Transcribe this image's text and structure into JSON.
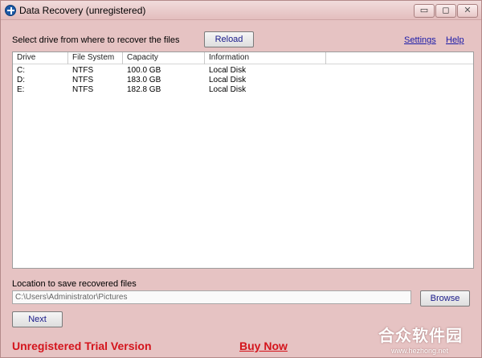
{
  "window": {
    "title": "Data Recovery (unregistered)",
    "min_glyph": "▭",
    "max_glyph": "◻",
    "close_glyph": "✕"
  },
  "top": {
    "prompt": "Select drive from where to recover the files",
    "reload_label": "Reload",
    "settings_label": "Settings",
    "help_label": "Help"
  },
  "drive_list": {
    "columns": [
      "Drive",
      "File System",
      "Capacity",
      "Information",
      ""
    ],
    "rows": [
      {
        "drive": "C:",
        "fs": "NTFS",
        "capacity": "100.0 GB",
        "info": "Local Disk"
      },
      {
        "drive": "D:",
        "fs": "NTFS",
        "capacity": "183.0 GB",
        "info": "Local Disk"
      },
      {
        "drive": "E:",
        "fs": "NTFS",
        "capacity": "182.8 GB",
        "info": "Local Disk"
      }
    ]
  },
  "save": {
    "label": "Location to save recovered files",
    "path": "C:\\Users\\Administrator\\Pictures",
    "browse_label": "Browse"
  },
  "footer": {
    "next_label": "Next",
    "trial_text": "Unregistered Trial Version",
    "buy_label": "Buy Now"
  },
  "watermark": {
    "logo_text": "合众软件园",
    "url": "www.hezhong.net"
  },
  "colors": {
    "background": "#e6c3c3",
    "accent_red": "#d4141c",
    "link_blue": "#1a1aa8"
  },
  "icons": {
    "app": "plus-circle-icon"
  }
}
